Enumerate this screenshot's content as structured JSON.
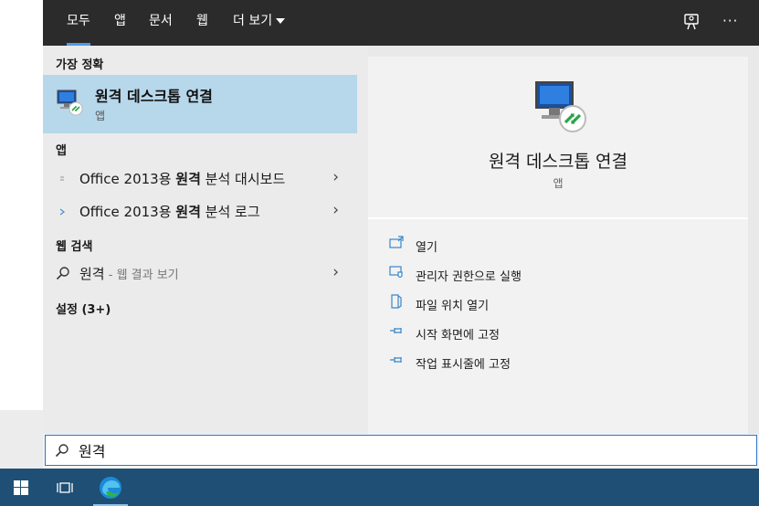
{
  "tabs": [
    {
      "label": "모두",
      "active": true
    },
    {
      "label": "앱"
    },
    {
      "label": "문서"
    },
    {
      "label": "웹"
    },
    {
      "label": "더 보기"
    }
  ],
  "header_icons": {
    "feedback": "feedback-icon",
    "more": "···"
  },
  "sections": {
    "best_match": "가장 정확",
    "apps": "앱",
    "web_search": "웹 검색",
    "settings": "설정 (3+)"
  },
  "best_match": {
    "title": "원격 데스크톱 연결",
    "subtitle": "앱",
    "icon": "remote-desktop-icon"
  },
  "apps": [
    {
      "prefix": "Office 2013용 ",
      "bold": "원격",
      "suffix": " 분석 대시보드"
    },
    {
      "prefix": "Office 2013용 ",
      "bold": "원격",
      "suffix": " 분석 로그"
    }
  ],
  "web_search": {
    "query": "원격",
    "hint": " - 웹 결과 보기"
  },
  "preview": {
    "title": "원격 데스크톱 연결",
    "subtitle": "앱",
    "icon": "remote-desktop-icon"
  },
  "actions": [
    {
      "label": "열기",
      "icon": "open-icon"
    },
    {
      "label": "관리자 권한으로 실행",
      "icon": "shield-run-icon"
    },
    {
      "label": "파일 위치 열기",
      "icon": "file-location-icon"
    },
    {
      "label": "시작 화면에 고정",
      "icon": "pin-icon"
    },
    {
      "label": "작업 표시줄에 고정",
      "icon": "pin-icon"
    }
  ],
  "search": {
    "value": "원격"
  },
  "taskbar": [
    {
      "icon": "windows-start-icon"
    },
    {
      "icon": "task-view-icon"
    },
    {
      "icon": "edge-browser-icon"
    }
  ],
  "colors": {
    "accent": "#4c9be8",
    "selection": "#b7d7ea",
    "taskbar": "#1f4f74",
    "header": "#2b2b2b"
  }
}
